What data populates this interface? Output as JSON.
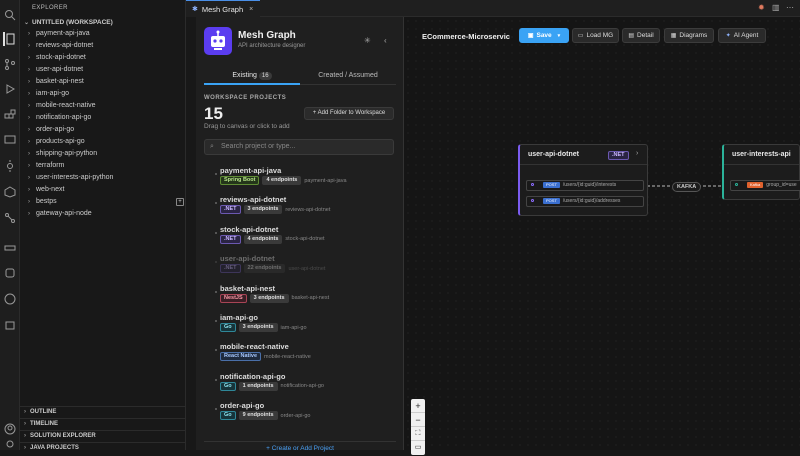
{
  "explorer": {
    "title": "EXPLORER",
    "workspace": "UNTITLED (WORKSPACE)",
    "items": [
      "payment-api-java",
      "reviews-api-dotnet",
      "stock-api-dotnet",
      "user-api-dotnet",
      "basket-api-nest",
      "iam-api-go",
      "mobile-react-native",
      "notification-api-go",
      "order-api-go",
      "products-api-go",
      "shipping-api-python",
      "terraform",
      "user-interests-api-python",
      "web-next",
      "bestps",
      "gateway-api-node"
    ],
    "sections": [
      "OUTLINE",
      "TIMELINE",
      "SOLUTION EXPLORER",
      "JAVA PROJECTS"
    ]
  },
  "tab": {
    "label": "Mesh Graph",
    "close": "×"
  },
  "panel": {
    "title": "Mesh Graph",
    "subtitle": "API architecture designer",
    "tab_existing": "Existing",
    "tab_existing_count": "16",
    "tab_created": "Created / Assumed",
    "ws_heading": "WORKSPACE PROJECTS",
    "ws_count": "15",
    "ws_hint": "Drag to canvas or click to add",
    "add_folder": "+ Add Folder to Workspace",
    "search_placeholder": "Search project or type...",
    "create": "+ Create or Add Project"
  },
  "projects": [
    {
      "name": "payment-api-java",
      "tech": "Spring Boot",
      "endpoints": "4 endpoints",
      "path": "payment-api-java"
    },
    {
      "name": "reviews-api-dotnet",
      "tech": ".NET",
      "endpoints": "3 endpoints",
      "path": "reviews-api-dotnet"
    },
    {
      "name": "stock-api-dotnet",
      "tech": ".NET",
      "endpoints": "4 endpoints",
      "path": "stock-api-dotnet"
    },
    {
      "name": "user-api-dotnet",
      "tech": ".NET",
      "endpoints": "22 endpoints",
      "path": "user-api-dotnet"
    },
    {
      "name": "basket-api-nest",
      "tech": "NestJS",
      "endpoints": "3 endpoints",
      "path": "basket-api-nest"
    },
    {
      "name": "iam-api-go",
      "tech": "Go",
      "endpoints": "3 endpoints",
      "path": "iam-api-go"
    },
    {
      "name": "mobile-react-native",
      "tech": "React Native",
      "endpoints": "",
      "path": "mobile-react-native"
    },
    {
      "name": "notification-api-go",
      "tech": "Go",
      "endpoints": "1 endpoints",
      "path": "notification-api-go"
    },
    {
      "name": "order-api-go",
      "tech": "Go",
      "endpoints": "9 endpoints",
      "path": "order-api-go"
    }
  ],
  "canvas": {
    "project_name": "ECommerce-Microservic",
    "save": "Save",
    "load": "Load MG",
    "detail": "Detail",
    "diagrams": "Diagrams",
    "ai_agent": "AI Agent",
    "node1": {
      "title": "user-api-dotnet",
      "tech": ".NET",
      "ep1_verb": "POST",
      "ep1": "/users/{id:guid}/interests",
      "ep2_verb": "POST",
      "ep2": "/users/{id:guid}/addresses"
    },
    "kafka": "KAFKA",
    "node2": {
      "title": "user-interests-api",
      "ep_verb": "Kafka",
      "ep": "group_id=use"
    }
  },
  "colors": {
    "accent": "#3aa3f5",
    "logo": "#5b3df0"
  }
}
